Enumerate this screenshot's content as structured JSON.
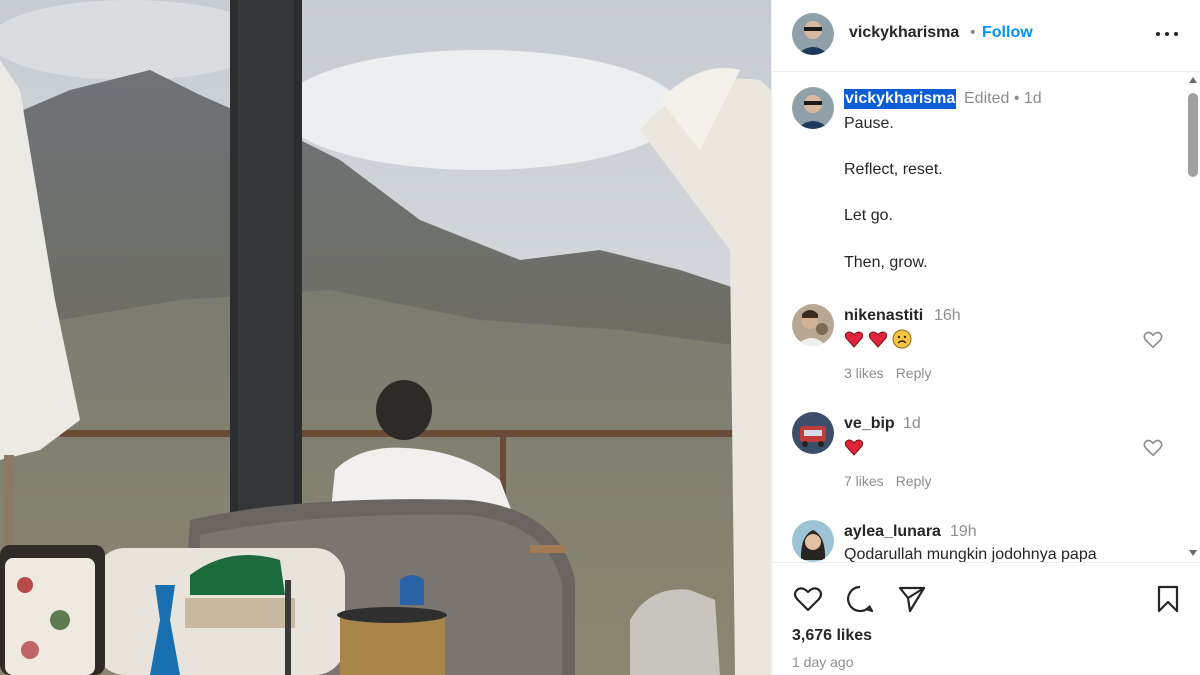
{
  "post": {
    "author": "vickykharisma",
    "follow_label": "Follow",
    "separator": "•",
    "likes": "3,676 likes",
    "date": "1 day ago"
  },
  "caption": {
    "username": "vickykharisma",
    "meta": "Edited •  1d",
    "lines": [
      "Pause.",
      "Reflect, reset.",
      "Let go.",
      "Then, grow."
    ]
  },
  "comments": [
    {
      "username": "nikenastiti",
      "time": "16h",
      "text": "",
      "emojis": [
        "red-heart",
        "red-heart",
        "sad-face"
      ],
      "likes": "3 likes",
      "reply": "Reply"
    },
    {
      "username": "ve_bip",
      "time": "1d",
      "text": "",
      "emojis": [
        "red-heart"
      ],
      "likes": "7 likes",
      "reply": "Reply"
    },
    {
      "username": "aylea_lunara",
      "time": "19h",
      "text": "Qodarullah mungkin jodohnya papa",
      "emojis": [],
      "likes": "",
      "reply": ""
    }
  ],
  "icons": {
    "more": "more-options-icon",
    "like": "heart-icon",
    "comment": "comment-icon",
    "share": "share-icon",
    "save": "bookmark-icon"
  },
  "colors": {
    "link": "#0095f6",
    "text": "#262626",
    "muted": "#8e8e8e",
    "selection": "#0b5cd7"
  }
}
